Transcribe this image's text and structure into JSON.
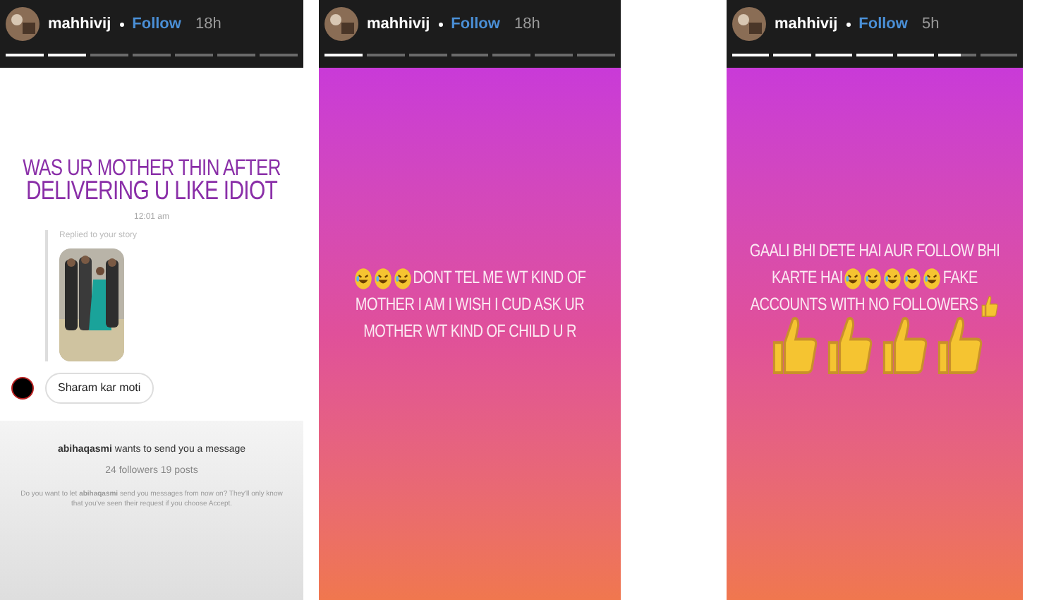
{
  "stories": [
    {
      "kind": "chat",
      "user": "mahhivij",
      "follow": "Follow",
      "time": "18h",
      "segments": [
        {
          "level": 1
        },
        {
          "level": 1
        },
        {
          "level": 0
        },
        {
          "level": 0
        },
        {
          "level": 0
        },
        {
          "level": 0
        },
        {
          "level": 0
        }
      ],
      "headline": [
        "WAS UR MOTHER THIN AFTER",
        "DELIVERING U LIKE IDIOT"
      ],
      "timestamp": "12:01 am",
      "reply_label": "Replied to your story",
      "reply_picture": {
        "kind": "picture"
      },
      "message": "Sharam kar moti",
      "request": {
        "title": "**abihaqasmi** wants to send you a message",
        "stats": "24 followers 19 posts",
        "note": "Do you want to let **abihaqasmi** send you messages from now on? They'll only know that you've seen their request if you choose Accept."
      }
    },
    {
      "kind": "text",
      "user": "mahhivij",
      "follow": "Follow",
      "time": "18h",
      "segments": [
        {
          "level": 1
        },
        {
          "level": 0
        },
        {
          "level": 0
        },
        {
          "level": 0
        },
        {
          "level": 0
        },
        {
          "level": 0
        },
        {
          "level": 0
        }
      ],
      "lines": [
        [
          {
            "kind": "laugh"
          },
          {
            "kind": "laugh"
          },
          {
            "kind": "laugh"
          },
          {
            "kind": "text",
            "text": "DONT TEL ME WT KIND OF"
          }
        ],
        [
          {
            "kind": "text",
            "text": "MOTHER I AM I WISH I CUD ASK UR"
          }
        ],
        [
          {
            "kind": "text",
            "text": "MOTHER WT KIND OF CHILD U R"
          }
        ]
      ]
    },
    {
      "kind": "text",
      "user": "mahhivij",
      "follow": "Follow",
      "time": "5h",
      "segments": [
        {
          "level": 1
        },
        {
          "level": 1
        },
        {
          "level": 1
        },
        {
          "level": 1
        },
        {
          "level": 1
        },
        {
          "level": 0.6
        },
        {
          "level": 0
        }
      ],
      "lines": [
        [
          {
            "kind": "text",
            "text": "GAALI BHI DETE HAI AUR FOLLOW BHI"
          }
        ],
        [
          {
            "kind": "text",
            "text": "KARTE HAI"
          },
          {
            "kind": "laugh"
          },
          {
            "kind": "laugh"
          },
          {
            "kind": "laugh"
          },
          {
            "kind": "laugh"
          },
          {
            "kind": "laugh"
          },
          {
            "kind": "text",
            "text": "FAKE"
          }
        ],
        [
          {
            "kind": "text",
            "text": "ACCOUNTS WITH NO FOLLOWERS"
          },
          {
            "kind": "thumb"
          }
        ],
        [
          {
            "kind": "bigthumb"
          },
          {
            "kind": "bigthumb"
          },
          {
            "kind": "bigthumb"
          },
          {
            "kind": "bigthumb"
          }
        ]
      ]
    }
  ]
}
